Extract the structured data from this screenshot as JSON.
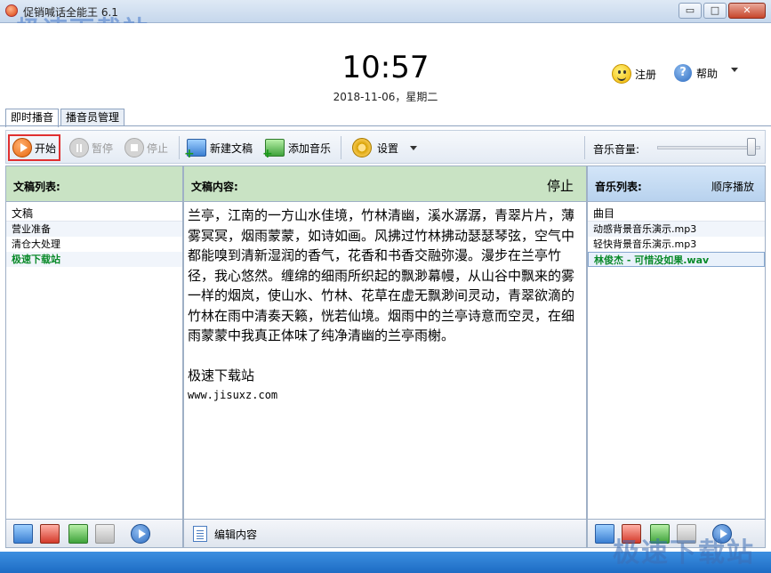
{
  "window": {
    "title": "促销喊话全能王 6.1",
    "watermark": "极速下载站",
    "buttons": {
      "minimize": "▭",
      "maximize": "□",
      "close": "✕"
    }
  },
  "header": {
    "time": "10:57",
    "date": "2018-11-06，星期二",
    "register_label": "注册",
    "help_label": "帮助"
  },
  "tabs": [
    {
      "label": "即时播音",
      "active": true
    },
    {
      "label": "播音员管理",
      "active": false
    }
  ],
  "toolbar": {
    "start": "开始",
    "pause": "暂停",
    "stop": "停止",
    "new_doc": "新建文稿",
    "add_music": "添加音乐",
    "settings": "设置",
    "volume_label": "音乐音量:",
    "volume_level": 0.95
  },
  "doc_list": {
    "title": "文稿列表:",
    "column": "文稿",
    "items": [
      {
        "name": "营业准备"
      },
      {
        "name": "清仓大处理"
      },
      {
        "name": "极速下载站",
        "selected": true
      }
    ]
  },
  "doc_content": {
    "title": "文稿内容:",
    "status": "停止",
    "paragraph": "兰亭，江南的一方山水佳境，竹林清幽，溪水潺潺，青翠片片，薄雾冥冥，烟雨蒙蒙，如诗如画。风拂过竹林拂动瑟瑟琴弦，空气中都能嗅到清新湿润的香气，花香和书香交融弥漫。漫步在兰亭竹径，我心悠然。缠绵的细雨所织起的飘渺幕幔，从山谷中飘来的雾一样的烟岚，使山水、竹林、花草在虚无飘渺间灵动，青翠欲滴的竹林在雨中清奏天籁，恍若仙境。烟雨中的兰亭诗意而空灵，在细雨蒙蒙中我真正体味了纯净清幽的兰亭雨榭。",
    "signature": "极速下载站",
    "url": "www.jisuxz.com",
    "edit_label": "编辑内容"
  },
  "music_list": {
    "title": "音乐列表:",
    "mode": "顺序播放",
    "column": "曲目",
    "items": [
      {
        "name": "动感背景音乐演示.mp3"
      },
      {
        "name": "轻快背景音乐演示.mp3"
      },
      {
        "name": "林俊杰 - 可惜没如果.wav",
        "selected": true
      }
    ]
  },
  "colors": {
    "accent_blue": "#1d6cc4",
    "panel_green": "#c9e3c4",
    "selected_green": "#0a8a2a",
    "highlight_red": "#e03030"
  }
}
